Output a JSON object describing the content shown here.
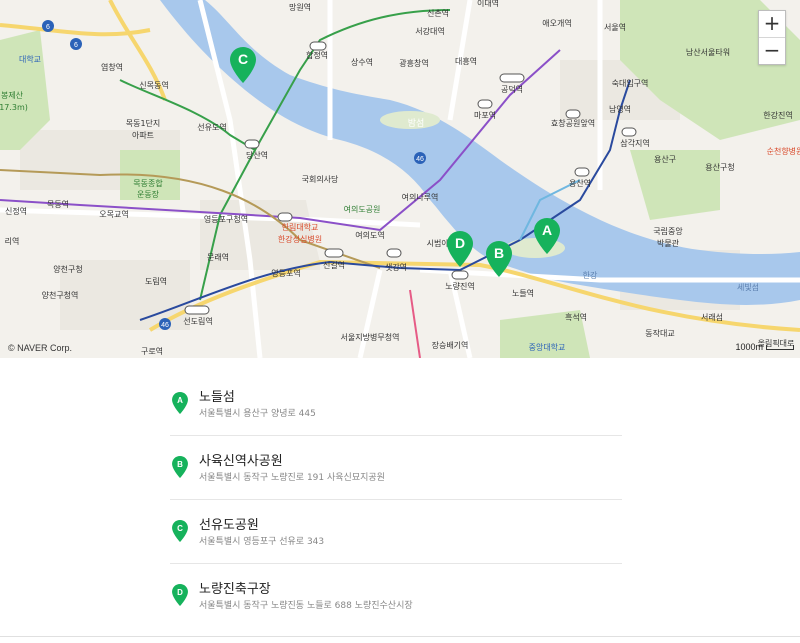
{
  "map": {
    "copyright": "© NAVER Corp.",
    "scale_label": "1000m",
    "zoom_in": "+",
    "zoom_out": "−",
    "colors": {
      "water": "#a8c8ec",
      "park": "#cfe5b8",
      "marker": "#16b25c",
      "subway_line2": "#37a04a",
      "subway_line5": "#8b50c8",
      "subway_line9": "#b59a58",
      "subway_line1": "#2a4a9e",
      "highway": "#f6d66e"
    },
    "places": {
      "north": [
        "망원역",
        "신촌역",
        "이대역",
        "애오개역",
        "서울역",
        "서강대역",
        "합정역",
        "상수역",
        "광흥창역",
        "대흥역",
        "공덕역",
        "남산서울타워",
        "숙대입구역",
        "효창공원앞역",
        "남영역",
        "마포역",
        "삼각지역",
        "용산구",
        "용산구청",
        "한강진역",
        "순천향병원"
      ],
      "west": [
        "대학교",
        "봉제산",
        "(17.3m)",
        "염창역",
        "신목동역",
        "목동1단지",
        "아파트",
        "선유도역",
        "당산역",
        "목동종합",
        "운동장",
        "목동역",
        "오목교역",
        "신정역",
        "리역",
        "양천구청",
        "양천구청역",
        "도림역",
        "문래역",
        "선도림역",
        "구로역"
      ],
      "center": [
        "밤섬",
        "국회의사당",
        "여의도공원",
        "여의나루역",
        "영등포구청역",
        "한림대학교",
        "한강성심병원",
        "여의도역",
        "신길역",
        "영등포역",
        "샛강역",
        "시범아파트",
        "노량진역",
        "노들역",
        "한강",
        "흑석역",
        "장승배기역",
        "중앙대학교",
        "서울지방병무청역",
        "용산역",
        "국립중앙",
        "박물관",
        "세빛섬",
        "서래섬",
        "동작대교",
        "올림픽대로"
      ],
      "highway_labels": [
        "6",
        "6",
        "46",
        "46"
      ]
    }
  },
  "results": [
    {
      "letter": "A",
      "name": "노들섬",
      "address": "서울특별시 용산구 양녕로 445"
    },
    {
      "letter": "B",
      "name": "사육신역사공원",
      "address": "서울특별시 동작구 노량진로 191 사육신묘지공원"
    },
    {
      "letter": "C",
      "name": "선유도공원",
      "address": "서울특별시 영등포구 선유로 343"
    },
    {
      "letter": "D",
      "name": "노량진축구장",
      "address": "서울특별시 동작구 노량진동 노들로 688 노량진수산시장"
    }
  ]
}
